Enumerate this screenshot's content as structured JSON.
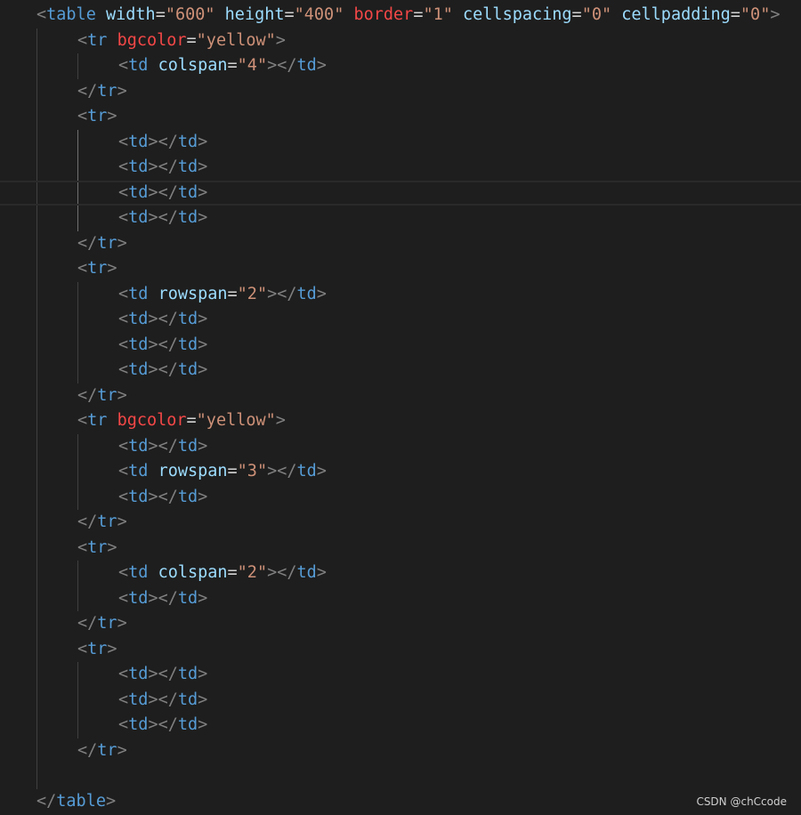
{
  "editor": {
    "theme": "dark",
    "colors": {
      "background": "#1e1e1e",
      "punctuation": "#808080",
      "tag": "#569cd6",
      "attribute": "#9cdcfe",
      "attribute_highlight": "#f44747",
      "value": "#ce9178"
    },
    "lines": [
      {
        "indent": 0,
        "tokens": [
          [
            "punc",
            "<"
          ],
          [
            "tag",
            "table"
          ],
          [
            "sp",
            " "
          ],
          [
            "attr",
            "width"
          ],
          [
            "eq",
            "="
          ],
          [
            "val",
            "\"600\""
          ],
          [
            "sp",
            " "
          ],
          [
            "attr",
            "height"
          ],
          [
            "eq",
            "="
          ],
          [
            "val",
            "\"400\""
          ],
          [
            "sp",
            " "
          ],
          [
            "attr-red",
            "border"
          ],
          [
            "eq",
            "="
          ],
          [
            "val",
            "\"1\""
          ],
          [
            "sp",
            " "
          ],
          [
            "attr",
            "cellspacing"
          ],
          [
            "eq",
            "="
          ],
          [
            "val",
            "\"0\""
          ],
          [
            "sp",
            " "
          ],
          [
            "attr",
            "cellpadding"
          ],
          [
            "eq",
            "="
          ],
          [
            "val",
            "\"0\""
          ],
          [
            "punc",
            ">"
          ]
        ]
      },
      {
        "indent": 1,
        "tokens": [
          [
            "punc",
            "<"
          ],
          [
            "tag",
            "tr"
          ],
          [
            "sp",
            " "
          ],
          [
            "attr-red",
            "bgcolor"
          ],
          [
            "eq",
            "="
          ],
          [
            "val",
            "\"yellow\""
          ],
          [
            "punc",
            ">"
          ]
        ]
      },
      {
        "indent": 2,
        "tokens": [
          [
            "punc",
            "<"
          ],
          [
            "tag",
            "td"
          ],
          [
            "sp",
            " "
          ],
          [
            "attr",
            "colspan"
          ],
          [
            "eq",
            "="
          ],
          [
            "val",
            "\"4\""
          ],
          [
            "punc",
            ">"
          ],
          [
            "punc",
            "</"
          ],
          [
            "tag",
            "td"
          ],
          [
            "punc",
            ">"
          ]
        ]
      },
      {
        "indent": 1,
        "tokens": [
          [
            "punc",
            "</"
          ],
          [
            "tag",
            "tr"
          ],
          [
            "punc",
            ">"
          ]
        ]
      },
      {
        "indent": 1,
        "tokens": [
          [
            "punc",
            "<"
          ],
          [
            "tag",
            "tr"
          ],
          [
            "punc",
            ">"
          ]
        ]
      },
      {
        "indent": 2,
        "tokens": [
          [
            "punc",
            "<"
          ],
          [
            "tag",
            "td"
          ],
          [
            "punc",
            ">"
          ],
          [
            "punc",
            "</"
          ],
          [
            "tag",
            "td"
          ],
          [
            "punc",
            ">"
          ]
        ]
      },
      {
        "indent": 2,
        "tokens": [
          [
            "punc",
            "<"
          ],
          [
            "tag",
            "td"
          ],
          [
            "punc",
            ">"
          ],
          [
            "punc",
            "</"
          ],
          [
            "tag",
            "td"
          ],
          [
            "punc",
            ">"
          ]
        ]
      },
      {
        "indent": 2,
        "current": true,
        "tokens": [
          [
            "punc",
            "<"
          ],
          [
            "tag",
            "td"
          ],
          [
            "punc",
            ">"
          ],
          [
            "punc",
            "</"
          ],
          [
            "tag",
            "td"
          ],
          [
            "punc",
            ">"
          ]
        ]
      },
      {
        "indent": 2,
        "tokens": [
          [
            "punc",
            "<"
          ],
          [
            "tag",
            "td"
          ],
          [
            "punc",
            ">"
          ],
          [
            "punc",
            "</"
          ],
          [
            "tag",
            "td"
          ],
          [
            "punc",
            ">"
          ]
        ]
      },
      {
        "indent": 1,
        "tokens": [
          [
            "punc",
            "</"
          ],
          [
            "tag",
            "tr"
          ],
          [
            "punc",
            ">"
          ]
        ]
      },
      {
        "indent": 1,
        "tokens": [
          [
            "punc",
            "<"
          ],
          [
            "tag",
            "tr"
          ],
          [
            "punc",
            ">"
          ]
        ]
      },
      {
        "indent": 2,
        "tokens": [
          [
            "punc",
            "<"
          ],
          [
            "tag",
            "td"
          ],
          [
            "sp",
            " "
          ],
          [
            "attr",
            "rowspan"
          ],
          [
            "eq",
            "="
          ],
          [
            "val",
            "\"2\""
          ],
          [
            "punc",
            ">"
          ],
          [
            "punc",
            "</"
          ],
          [
            "tag",
            "td"
          ],
          [
            "punc",
            ">"
          ]
        ]
      },
      {
        "indent": 2,
        "tokens": [
          [
            "punc",
            "<"
          ],
          [
            "tag",
            "td"
          ],
          [
            "punc",
            ">"
          ],
          [
            "punc",
            "</"
          ],
          [
            "tag",
            "td"
          ],
          [
            "punc",
            ">"
          ]
        ]
      },
      {
        "indent": 2,
        "tokens": [
          [
            "punc",
            "<"
          ],
          [
            "tag",
            "td"
          ],
          [
            "punc",
            ">"
          ],
          [
            "punc",
            "</"
          ],
          [
            "tag",
            "td"
          ],
          [
            "punc",
            ">"
          ]
        ]
      },
      {
        "indent": 2,
        "tokens": [
          [
            "punc",
            "<"
          ],
          [
            "tag",
            "td"
          ],
          [
            "punc",
            ">"
          ],
          [
            "punc",
            "</"
          ],
          [
            "tag",
            "td"
          ],
          [
            "punc",
            ">"
          ]
        ]
      },
      {
        "indent": 1,
        "tokens": [
          [
            "punc",
            "</"
          ],
          [
            "tag",
            "tr"
          ],
          [
            "punc",
            ">"
          ]
        ]
      },
      {
        "indent": 1,
        "tokens": [
          [
            "punc",
            "<"
          ],
          [
            "tag",
            "tr"
          ],
          [
            "sp",
            " "
          ],
          [
            "attr-red",
            "bgcolor"
          ],
          [
            "eq",
            "="
          ],
          [
            "val",
            "\"yellow\""
          ],
          [
            "punc",
            ">"
          ]
        ]
      },
      {
        "indent": 2,
        "tokens": [
          [
            "punc",
            "<"
          ],
          [
            "tag",
            "td"
          ],
          [
            "punc",
            ">"
          ],
          [
            "punc",
            "</"
          ],
          [
            "tag",
            "td"
          ],
          [
            "punc",
            ">"
          ]
        ]
      },
      {
        "indent": 2,
        "tokens": [
          [
            "punc",
            "<"
          ],
          [
            "tag",
            "td"
          ],
          [
            "sp",
            " "
          ],
          [
            "attr",
            "rowspan"
          ],
          [
            "eq",
            "="
          ],
          [
            "val",
            "\"3\""
          ],
          [
            "punc",
            ">"
          ],
          [
            "punc",
            "</"
          ],
          [
            "tag",
            "td"
          ],
          [
            "punc",
            ">"
          ]
        ]
      },
      {
        "indent": 2,
        "tokens": [
          [
            "punc",
            "<"
          ],
          [
            "tag",
            "td"
          ],
          [
            "punc",
            ">"
          ],
          [
            "punc",
            "</"
          ],
          [
            "tag",
            "td"
          ],
          [
            "punc",
            ">"
          ]
        ]
      },
      {
        "indent": 1,
        "tokens": [
          [
            "punc",
            "</"
          ],
          [
            "tag",
            "tr"
          ],
          [
            "punc",
            ">"
          ]
        ]
      },
      {
        "indent": 1,
        "tokens": [
          [
            "punc",
            "<"
          ],
          [
            "tag",
            "tr"
          ],
          [
            "punc",
            ">"
          ]
        ]
      },
      {
        "indent": 2,
        "tokens": [
          [
            "punc",
            "<"
          ],
          [
            "tag",
            "td"
          ],
          [
            "sp",
            " "
          ],
          [
            "attr",
            "colspan"
          ],
          [
            "eq",
            "="
          ],
          [
            "val",
            "\"2\""
          ],
          [
            "punc",
            ">"
          ],
          [
            "punc",
            "</"
          ],
          [
            "tag",
            "td"
          ],
          [
            "punc",
            ">"
          ]
        ]
      },
      {
        "indent": 2,
        "tokens": [
          [
            "punc",
            "<"
          ],
          [
            "tag",
            "td"
          ],
          [
            "punc",
            ">"
          ],
          [
            "punc",
            "</"
          ],
          [
            "tag",
            "td"
          ],
          [
            "punc",
            ">"
          ]
        ]
      },
      {
        "indent": 1,
        "tokens": [
          [
            "punc",
            "</"
          ],
          [
            "tag",
            "tr"
          ],
          [
            "punc",
            ">"
          ]
        ]
      },
      {
        "indent": 1,
        "tokens": [
          [
            "punc",
            "<"
          ],
          [
            "tag",
            "tr"
          ],
          [
            "punc",
            ">"
          ]
        ]
      },
      {
        "indent": 2,
        "tokens": [
          [
            "punc",
            "<"
          ],
          [
            "tag",
            "td"
          ],
          [
            "punc",
            ">"
          ],
          [
            "punc",
            "</"
          ],
          [
            "tag",
            "td"
          ],
          [
            "punc",
            ">"
          ]
        ]
      },
      {
        "indent": 2,
        "tokens": [
          [
            "punc",
            "<"
          ],
          [
            "tag",
            "td"
          ],
          [
            "punc",
            ">"
          ],
          [
            "punc",
            "</"
          ],
          [
            "tag",
            "td"
          ],
          [
            "punc",
            ">"
          ]
        ]
      },
      {
        "indent": 2,
        "tokens": [
          [
            "punc",
            "<"
          ],
          [
            "tag",
            "td"
          ],
          [
            "punc",
            ">"
          ],
          [
            "punc",
            "</"
          ],
          [
            "tag",
            "td"
          ],
          [
            "punc",
            ">"
          ]
        ]
      },
      {
        "indent": 1,
        "tokens": [
          [
            "punc",
            "</"
          ],
          [
            "tag",
            "tr"
          ],
          [
            "punc",
            ">"
          ]
        ]
      },
      {
        "indent": 0,
        "tokens": []
      },
      {
        "indent": 0,
        "tokens": [
          [
            "punc",
            "</"
          ],
          [
            "tag",
            "table"
          ],
          [
            "punc",
            ">"
          ]
        ]
      }
    ]
  },
  "watermark": {
    "text": "CSDN @chCcode"
  }
}
